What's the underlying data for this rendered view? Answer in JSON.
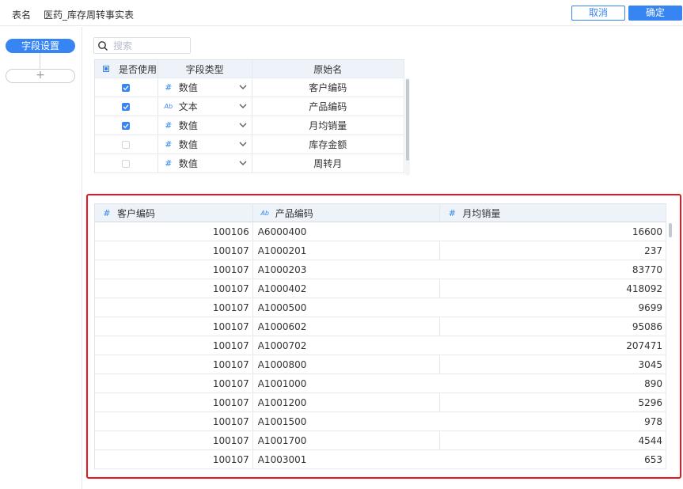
{
  "header": {
    "table_label": "表名",
    "table_name": "医药_库存周转事实表",
    "cancel_label": "取消",
    "confirm_label": "确定"
  },
  "sidebar": {
    "active_item": "字段设置",
    "add_symbol": "+"
  },
  "search": {
    "placeholder": "搜索",
    "value": ""
  },
  "field_table": {
    "headers": [
      "是否使用",
      "字段类型",
      "原始名"
    ],
    "rows": [
      {
        "checked": true,
        "type_icon": "#",
        "type": "数值",
        "name": "客户编码"
      },
      {
        "checked": true,
        "type_icon": "Ab",
        "type": "文本",
        "name": "产品编码"
      },
      {
        "checked": true,
        "type_icon": "#",
        "type": "数值",
        "name": "月均销量"
      },
      {
        "checked": false,
        "type_icon": "#",
        "type": "数值",
        "name": "库存金额"
      },
      {
        "checked": false,
        "type_icon": "#",
        "type": "数值",
        "name": "周转月"
      }
    ]
  },
  "preview_table": {
    "headers": [
      {
        "icon": "#",
        "label": "客户编码"
      },
      {
        "icon": "Ab",
        "label": "产品编码"
      },
      {
        "icon": "#",
        "label": "月均销量"
      }
    ],
    "rows": [
      {
        "c1": "100106",
        "c2": "A6000400",
        "c3": "16600"
      },
      {
        "c1": "100107",
        "c2": "A1000201",
        "c3": "237"
      },
      {
        "c1": "100107",
        "c2": "A1000203",
        "c3": "83770"
      },
      {
        "c1": "100107",
        "c2": "A1000402",
        "c3": "418092"
      },
      {
        "c1": "100107",
        "c2": "A1000500",
        "c3": "9699"
      },
      {
        "c1": "100107",
        "c2": "A1000602",
        "c3": "95086"
      },
      {
        "c1": "100107",
        "c2": "A1000702",
        "c3": "207471"
      },
      {
        "c1": "100107",
        "c2": "A1000800",
        "c3": "3045"
      },
      {
        "c1": "100107",
        "c2": "A1001000",
        "c3": "890"
      },
      {
        "c1": "100107",
        "c2": "A1001200",
        "c3": "5296"
      },
      {
        "c1": "100107",
        "c2": "A1001500",
        "c3": "978"
      },
      {
        "c1": "100107",
        "c2": "A1001700",
        "c3": "4544"
      },
      {
        "c1": "100107",
        "c2": "A1003001",
        "c3": "653"
      }
    ]
  },
  "colors": {
    "accent": "#3685f2",
    "highlight_border": "#e8151f",
    "header_bg": "#eef2f9"
  }
}
